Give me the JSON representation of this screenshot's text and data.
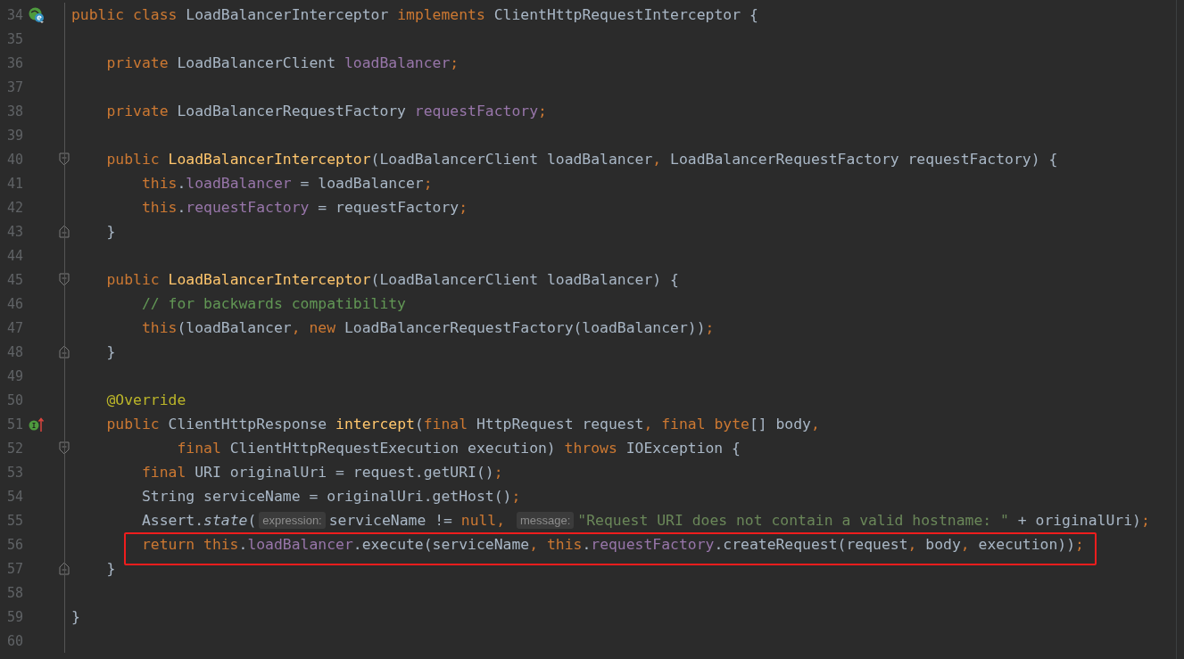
{
  "lines": [
    {
      "number": "34",
      "gutter_icon": {
        "kind": "class"
      },
      "boxed": false,
      "tokens": [
        {
          "kind": "kw",
          "text": "public class "
        },
        {
          "kind": "plain",
          "text": "LoadBalancerInterceptor "
        },
        {
          "kind": "kw",
          "text": "implements "
        },
        {
          "kind": "plain",
          "text": "ClientHttpRequestInterceptor {"
        }
      ]
    },
    {
      "number": "35",
      "boxed": false
    },
    {
      "number": "36",
      "boxed": false,
      "tokens": [
        {
          "kind": "kw",
          "text": "    private "
        },
        {
          "kind": "plain",
          "text": "LoadBalancerClient "
        },
        {
          "kind": "field",
          "text": "loadBalancer"
        },
        {
          "kind": "kw",
          "text": ";"
        }
      ]
    },
    {
      "number": "37",
      "boxed": false
    },
    {
      "number": "38",
      "boxed": false,
      "tokens": [
        {
          "kind": "kw",
          "text": "    private "
        },
        {
          "kind": "plain",
          "text": "LoadBalancerRequestFactory "
        },
        {
          "kind": "field",
          "text": "requestFactory"
        },
        {
          "kind": "kw",
          "text": ";"
        }
      ]
    },
    {
      "number": "39",
      "boxed": false
    },
    {
      "number": "40",
      "fold": {
        "kind": "start"
      },
      "boxed": false,
      "tokens": [
        {
          "kind": "kw",
          "text": "    public "
        },
        {
          "kind": "decl",
          "text": "LoadBalancerInterceptor"
        },
        {
          "kind": "plain",
          "text": "(LoadBalancerClient loadBalancer"
        },
        {
          "kind": "kw",
          "text": ", "
        },
        {
          "kind": "plain",
          "text": "LoadBalancerRequestFactory requestFactory) {"
        }
      ]
    },
    {
      "number": "41",
      "boxed": false,
      "tokens": [
        {
          "kind": "kw",
          "text": "        this"
        },
        {
          "kind": "plain",
          "text": "."
        },
        {
          "kind": "field",
          "text": "loadBalancer"
        },
        {
          "kind": "plain",
          "text": " = loadBalancer"
        },
        {
          "kind": "kw",
          "text": ";"
        }
      ]
    },
    {
      "number": "42",
      "boxed": false,
      "tokens": [
        {
          "kind": "kw",
          "text": "        this"
        },
        {
          "kind": "plain",
          "text": "."
        },
        {
          "kind": "field",
          "text": "requestFactory"
        },
        {
          "kind": "plain",
          "text": " = requestFactory"
        },
        {
          "kind": "kw",
          "text": ";"
        }
      ]
    },
    {
      "number": "43",
      "fold": {
        "kind": "end"
      },
      "boxed": false,
      "tokens": [
        {
          "kind": "plain",
          "text": "    }"
        }
      ]
    },
    {
      "number": "44",
      "boxed": false
    },
    {
      "number": "45",
      "fold": {
        "kind": "start"
      },
      "boxed": false,
      "tokens": [
        {
          "kind": "kw",
          "text": "    public "
        },
        {
          "kind": "decl",
          "text": "LoadBalancerInterceptor"
        },
        {
          "kind": "plain",
          "text": "(LoadBalancerClient loadBalancer) {"
        }
      ]
    },
    {
      "number": "46",
      "boxed": false,
      "tokens": [
        {
          "kind": "comment",
          "text": "        // for backwards compatibility"
        }
      ]
    },
    {
      "number": "47",
      "boxed": false,
      "tokens": [
        {
          "kind": "kw",
          "text": "        this"
        },
        {
          "kind": "plain",
          "text": "(loadBalancer"
        },
        {
          "kind": "kw",
          "text": ", new "
        },
        {
          "kind": "plain",
          "text": "LoadBalancerRequestFactory(loadBalancer))"
        },
        {
          "kind": "kw",
          "text": ";"
        }
      ]
    },
    {
      "number": "48",
      "fold": {
        "kind": "end"
      },
      "boxed": false,
      "tokens": [
        {
          "kind": "plain",
          "text": "    }"
        }
      ]
    },
    {
      "number": "49",
      "boxed": false
    },
    {
      "number": "50",
      "boxed": false,
      "tokens": [
        {
          "kind": "annotation",
          "text": "    @Override"
        }
      ]
    },
    {
      "number": "51",
      "gutter_icon": {
        "kind": "implements"
      },
      "boxed": false,
      "tokens": [
        {
          "kind": "kw",
          "text": "    public "
        },
        {
          "kind": "plain",
          "text": "ClientHttpResponse "
        },
        {
          "kind": "decl",
          "text": "intercept"
        },
        {
          "kind": "plain",
          "text": "("
        },
        {
          "kind": "kw",
          "text": "final "
        },
        {
          "kind": "plain",
          "text": "HttpRequest request"
        },
        {
          "kind": "kw",
          "text": ", final byte"
        },
        {
          "kind": "plain",
          "text": "[] body"
        },
        {
          "kind": "kw",
          "text": ","
        }
      ]
    },
    {
      "number": "52",
      "fold": {
        "kind": "start"
      },
      "boxed": false,
      "tokens": [
        {
          "kind": "kw",
          "text": "            final "
        },
        {
          "kind": "plain",
          "text": "ClientHttpRequestExecution execution) "
        },
        {
          "kind": "kw",
          "text": "throws "
        },
        {
          "kind": "plain",
          "text": "IOException {"
        }
      ]
    },
    {
      "number": "53",
      "boxed": false,
      "tokens": [
        {
          "kind": "kw",
          "text": "        final "
        },
        {
          "kind": "plain",
          "text": "URI originalUri = request.getURI()"
        },
        {
          "kind": "kw",
          "text": ";"
        }
      ]
    },
    {
      "number": "54",
      "boxed": false,
      "tokens": [
        {
          "kind": "plain",
          "text": "        String serviceName = originalUri.getHost()"
        },
        {
          "kind": "kw",
          "text": ";"
        }
      ]
    },
    {
      "number": "55",
      "boxed": false,
      "tokens": [
        {
          "kind": "plain",
          "text": "        Assert."
        },
        {
          "kind": "italic",
          "text": "state"
        },
        {
          "kind": "plain",
          "text": "("
        },
        {
          "kind": "hint",
          "text": "expression:"
        },
        {
          "kind": "plain",
          "text": "serviceName != "
        },
        {
          "kind": "kw",
          "text": "null, "
        },
        {
          "kind": "hint",
          "text": "message:"
        },
        {
          "kind": "string",
          "text": "\"Request URI does not contain a valid hostname: \""
        },
        {
          "kind": "plain",
          "text": " + originalUri)"
        },
        {
          "kind": "kw",
          "text": ";"
        }
      ]
    },
    {
      "number": "56",
      "boxed": true,
      "tokens": [
        {
          "kind": "kw",
          "text": "        return this"
        },
        {
          "kind": "plain",
          "text": "."
        },
        {
          "kind": "field",
          "text": "loadBalancer"
        },
        {
          "kind": "plain",
          "text": ".execute(serviceName"
        },
        {
          "kind": "kw",
          "text": ", this"
        },
        {
          "kind": "plain",
          "text": "."
        },
        {
          "kind": "field",
          "text": "requestFactory"
        },
        {
          "kind": "plain",
          "text": ".createRequest(request"
        },
        {
          "kind": "kw",
          "text": ", "
        },
        {
          "kind": "plain",
          "text": "body"
        },
        {
          "kind": "kw",
          "text": ", "
        },
        {
          "kind": "plain",
          "text": "execution))"
        },
        {
          "kind": "kw",
          "text": ";"
        }
      ]
    },
    {
      "number": "57",
      "fold": {
        "kind": "end"
      },
      "boxed": false,
      "tokens": [
        {
          "kind": "plain",
          "text": "    }"
        }
      ]
    },
    {
      "number": "58",
      "boxed": false
    },
    {
      "number": "59",
      "boxed": false,
      "tokens": [
        {
          "kind": "plain",
          "text": "}"
        }
      ]
    },
    {
      "number": "60",
      "boxed": false
    }
  ]
}
